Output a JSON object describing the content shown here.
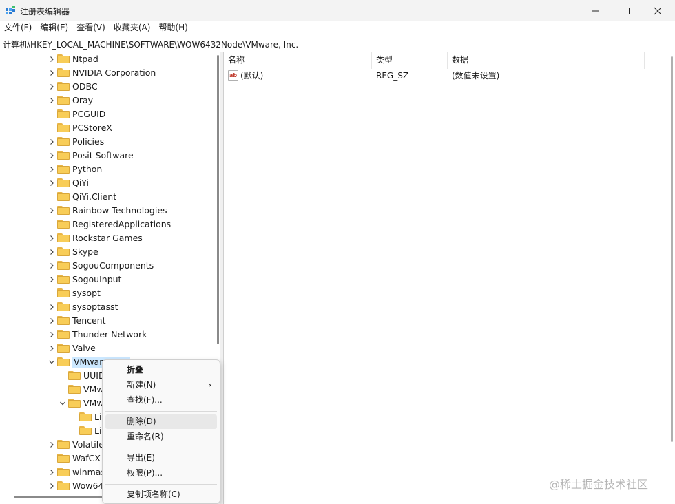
{
  "window": {
    "title": "注册表编辑器",
    "minimize": "—",
    "maximize": "☐",
    "close": "✕"
  },
  "menu": [
    "文件(F)",
    "编辑(E)",
    "查看(V)",
    "收藏夹(A)",
    "帮助(H)"
  ],
  "address": "计算机\\HKEY_LOCAL_MACHINE\\SOFTWARE\\WOW6432Node\\VMware, Inc.",
  "tree": [
    {
      "label": "Ntpad",
      "expander": "collapsed",
      "level": 0
    },
    {
      "label": "NVIDIA Corporation",
      "expander": "collapsed",
      "level": 0
    },
    {
      "label": "ODBC",
      "expander": "collapsed",
      "level": 0
    },
    {
      "label": "Oray",
      "expander": "collapsed",
      "level": 0
    },
    {
      "label": "PCGUID",
      "expander": "none",
      "level": 0
    },
    {
      "label": "PCStoreX",
      "expander": "none",
      "level": 0
    },
    {
      "label": "Policies",
      "expander": "collapsed",
      "level": 0
    },
    {
      "label": "Posit Software",
      "expander": "collapsed",
      "level": 0
    },
    {
      "label": "Python",
      "expander": "collapsed",
      "level": 0
    },
    {
      "label": "QiYi",
      "expander": "collapsed",
      "level": 0
    },
    {
      "label": "QiYi.Client",
      "expander": "none",
      "level": 0
    },
    {
      "label": "Rainbow Technologies",
      "expander": "collapsed",
      "level": 0
    },
    {
      "label": "RegisteredApplications",
      "expander": "none",
      "level": 0
    },
    {
      "label": "Rockstar Games",
      "expander": "collapsed",
      "level": 0
    },
    {
      "label": "Skype",
      "expander": "collapsed",
      "level": 0
    },
    {
      "label": "SogouComponents",
      "expander": "collapsed",
      "level": 0
    },
    {
      "label": "SogouInput",
      "expander": "collapsed",
      "level": 0
    },
    {
      "label": "sysopt",
      "expander": "none",
      "level": 0
    },
    {
      "label": "sysoptasst",
      "expander": "collapsed",
      "level": 0
    },
    {
      "label": "Tencent",
      "expander": "collapsed",
      "level": 0
    },
    {
      "label": "Thunder Network",
      "expander": "collapsed",
      "level": 0
    },
    {
      "label": "Valve",
      "expander": "collapsed",
      "level": 0
    },
    {
      "label": "VMware, Inc.",
      "expander": "expanded",
      "level": 0,
      "selected": true
    },
    {
      "label": "UUID",
      "expander": "none",
      "level": 1
    },
    {
      "label": "VMware",
      "expander": "none",
      "level": 1
    },
    {
      "label": "VMware",
      "expander": "expanded",
      "level": 1
    },
    {
      "label": "Li",
      "expander": "none",
      "level": 2
    },
    {
      "label": "Li",
      "expander": "none",
      "level": 2
    },
    {
      "label": "Volatile",
      "expander": "collapsed",
      "level": 0
    },
    {
      "label": "WafCX",
      "expander": "none",
      "level": 0
    },
    {
      "label": "winmas",
      "expander": "collapsed",
      "level": 0
    },
    {
      "label": "Wow64",
      "expander": "collapsed",
      "level": 0
    }
  ],
  "list": {
    "columns": [
      "名称",
      "类型",
      "数据"
    ],
    "rows": [
      {
        "icon": "ab",
        "name": "(默认)",
        "type": "REG_SZ",
        "data": "(数值未设置)"
      }
    ]
  },
  "context_menu": [
    {
      "label": "折叠",
      "bold": true
    },
    {
      "label": "新建(N)",
      "submenu": "›"
    },
    {
      "label": "查找(F)..."
    },
    {
      "separator": true
    },
    {
      "label": "删除(D)",
      "hover": true
    },
    {
      "label": "重命名(R)"
    },
    {
      "separator": true
    },
    {
      "label": "导出(E)"
    },
    {
      "label": "权限(P)..."
    },
    {
      "separator": true
    },
    {
      "label": "复制项名称(C)"
    }
  ],
  "watermark": "@稀土掘金技术社区",
  "colors": {
    "selection": "#cce8ff",
    "folder": "#f8cd58",
    "titlebar": "#f3f3f3"
  }
}
